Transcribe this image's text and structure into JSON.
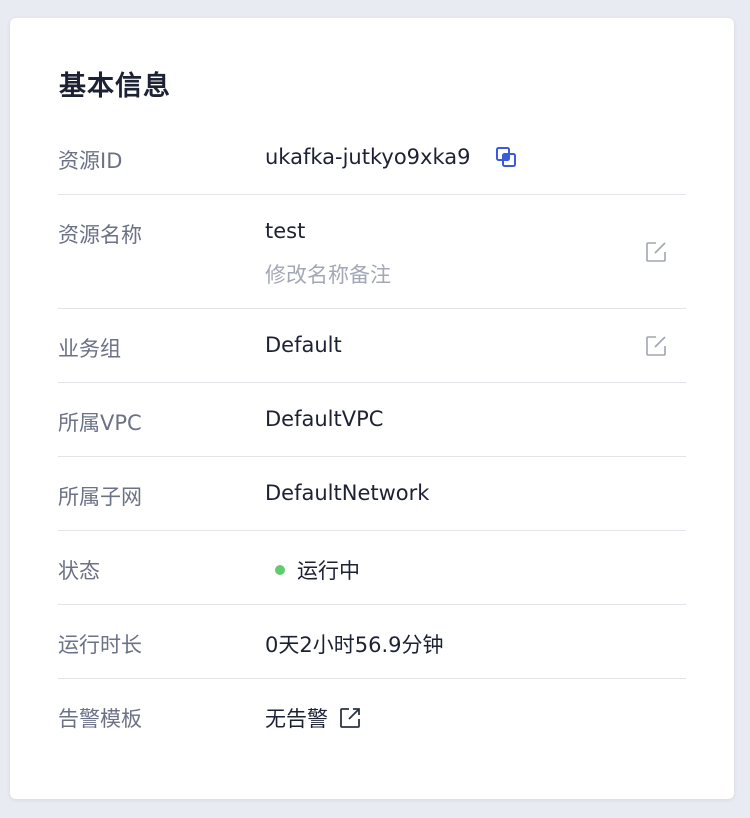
{
  "title": "基本信息",
  "rows": {
    "resource_id": {
      "label": "资源ID",
      "value": "ukafka-jutkyo9xka9"
    },
    "resource_name": {
      "label": "资源名称",
      "value": "test",
      "hint": "修改名称备注"
    },
    "business_group": {
      "label": "业务组",
      "value": "Default"
    },
    "vpc": {
      "label": "所属VPC",
      "value": "DefaultVPC"
    },
    "subnet": {
      "label": "所属子网",
      "value": "DefaultNetwork"
    },
    "status": {
      "label": "状态",
      "value": "运行中"
    },
    "uptime": {
      "label": "运行时长",
      "value": "0天2小时56.9分钟"
    },
    "alarm_template": {
      "label": "告警模板",
      "value": "无告警"
    }
  },
  "icons": {
    "copy": "copy-icon",
    "edit": "edit-icon",
    "external_link": "external-link-icon"
  },
  "colors": {
    "accent": "#3b5bdb",
    "status_running": "#5fcc6e",
    "label": "#6b7285",
    "text": "#1c2233",
    "hint": "#a3a8b6",
    "icon_gray": "#a0a5b1"
  }
}
